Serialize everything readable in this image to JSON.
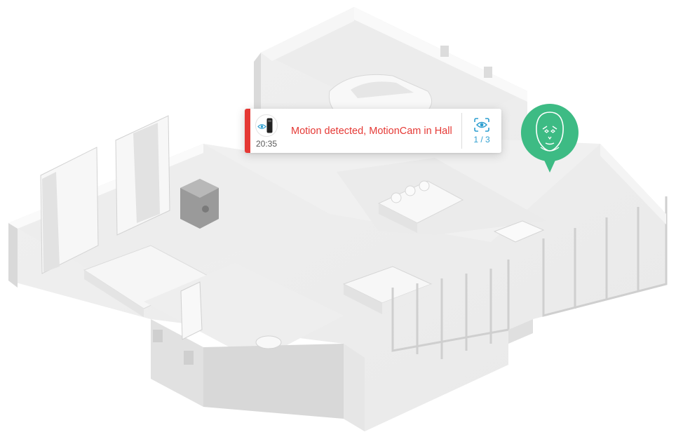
{
  "notification": {
    "time": "20:35",
    "message": "Motion detected, MotionCam in Hall",
    "counter": "1 / 3",
    "accent_color": "#e53935",
    "action_color": "#2e9fd0",
    "device_icon": "motioncam-device-icon",
    "action_icon": "eye-scan-icon"
  },
  "face_marker": {
    "color": "#3dbb84",
    "icon": "face-recognition-icon"
  },
  "scene": {
    "description_icon": "house-floorplan-3d"
  }
}
